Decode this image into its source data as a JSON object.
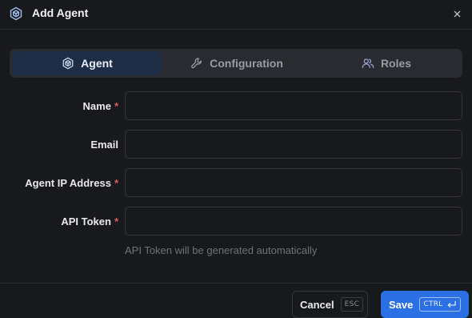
{
  "dialog": {
    "title": "Add Agent",
    "title_icon": "agent-hexagon-icon",
    "close_icon": "close-icon"
  },
  "tabs": [
    {
      "label": "Agent",
      "icon": "agent-hexagon-icon",
      "active": true
    },
    {
      "label": "Configuration",
      "icon": "wrench-icon",
      "active": false
    },
    {
      "label": "Roles",
      "icon": "users-icon",
      "active": false
    }
  ],
  "form": {
    "name": {
      "label": "Name",
      "required_mark": "*",
      "value": ""
    },
    "email": {
      "label": "Email",
      "value": ""
    },
    "ip_address": {
      "label": "Agent IP Address",
      "required_mark": "*",
      "value": ""
    },
    "api_token": {
      "label": "API Token",
      "required_mark": "*",
      "value": "",
      "hint": "API Token will be generated automatically"
    }
  },
  "footer": {
    "cancel_label": "Cancel",
    "cancel_shortcut": "ESC",
    "save_label": "Save",
    "save_shortcut": "CTRL"
  },
  "colors": {
    "background": "#18191c",
    "accent": "#2b6fe4",
    "active_tab": "#1c2d45",
    "required": "#e25a5a"
  }
}
